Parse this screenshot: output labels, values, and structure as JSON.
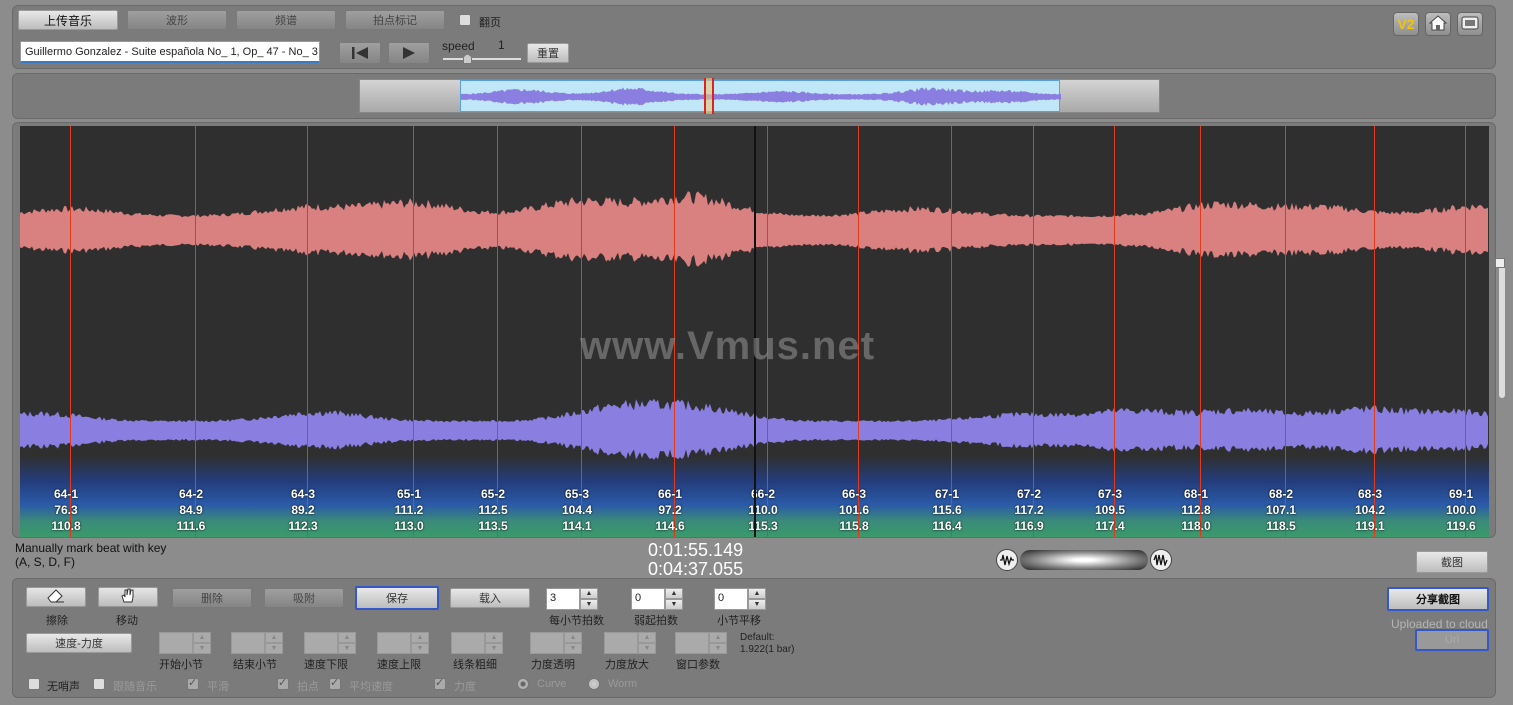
{
  "toolbar": {
    "upload_label": "上传音乐",
    "waveform_label": "波形",
    "spectrum_label": "频谱",
    "beatmark_label": "拍点标记",
    "page_label": "翻页",
    "filename": "Guillermo Gonzalez - Suite española No_ 1, Op_ 47 - No_ 3",
    "speed_label": "speed",
    "speed_value": "1",
    "reset_label": "重置",
    "v2_label": "V2"
  },
  "colors": {
    "wave_top": "#d98080",
    "wave_bottom": "#8a7fe0",
    "beatline": "#e23a1a",
    "canvas_bg": "#2f2f2f"
  },
  "main": {
    "watermark": "www.Vmus.net",
    "beats": [
      {
        "label": "64-1",
        "tempo": "76.3",
        "time": "110.8"
      },
      {
        "label": "64-2",
        "tempo": "84.9",
        "time": "111.6"
      },
      {
        "label": "64-3",
        "tempo": "89.2",
        "time": "112.3"
      },
      {
        "label": "65-1",
        "tempo": "111.2",
        "time": "113.0"
      },
      {
        "label": "65-2",
        "tempo": "112.5",
        "time": "113.5"
      },
      {
        "label": "65-3",
        "tempo": "104.4",
        "time": "114.1"
      },
      {
        "label": "66-1",
        "tempo": "97.2",
        "time": "114.6"
      },
      {
        "label": "66-2",
        "tempo": "110.0",
        "time": "115.3"
      },
      {
        "label": "66-3",
        "tempo": "101.6",
        "time": "115.8"
      },
      {
        "label": "67-1",
        "tempo": "115.6",
        "time": "116.4"
      },
      {
        "label": "67-2",
        "tempo": "117.2",
        "time": "116.9"
      },
      {
        "label": "67-3",
        "tempo": "109.5",
        "time": "117.4"
      },
      {
        "label": "68-1",
        "tempo": "112.8",
        "time": "118.0"
      },
      {
        "label": "68-2",
        "tempo": "107.1",
        "time": "118.5"
      },
      {
        "label": "68-3",
        "tempo": "104.2",
        "time": "119.1"
      },
      {
        "label": "69-1",
        "tempo": "100.0",
        "time": "119.6"
      }
    ]
  },
  "status": {
    "hint_line1": "Manually mark beat with key",
    "hint_line2": "(A, S, D, F)",
    "current_time": "0:01:55.149",
    "total_time": "0:04:37.055",
    "screenshot_label": "截图"
  },
  "controls": {
    "erase_label": "擦除",
    "move_label": "移动",
    "delete_label": "删除",
    "snap_label": "吸附",
    "save_label": "保存",
    "load_label": "载入",
    "beats_per_bar_value": "3",
    "beats_per_bar_label": "每小节拍数",
    "pickup_value": "0",
    "pickup_label": "弱起拍数",
    "bar_shift_value": "0",
    "bar_shift_label": "小节平移",
    "tempo_dynamics_label": "速度-力度",
    "start_bar_label": "开始小节",
    "end_bar_label": "结束小节",
    "tempo_low_label": "速度下限",
    "tempo_high_label": "速度上限",
    "line_width_label": "线条粗细",
    "dyn_transparency_label": "力度透明",
    "dyn_scale_label": "力度放大",
    "window_param_label": "窗口参数",
    "default_line1": "Default:",
    "default_line2": "1.922(1 bar)",
    "no_mute_label": "无哨声",
    "follow_music_label": "跟随音乐",
    "smooth_label": "平滑",
    "beat_label": "拍点",
    "avg_tempo_label": "平均速度",
    "dynamics_label": "力度",
    "curve_label": "Curve",
    "worm_label": "Worm",
    "share_label": "分享截图",
    "uploaded_label": "Uploaded to cloud",
    "url_label": "Url"
  }
}
